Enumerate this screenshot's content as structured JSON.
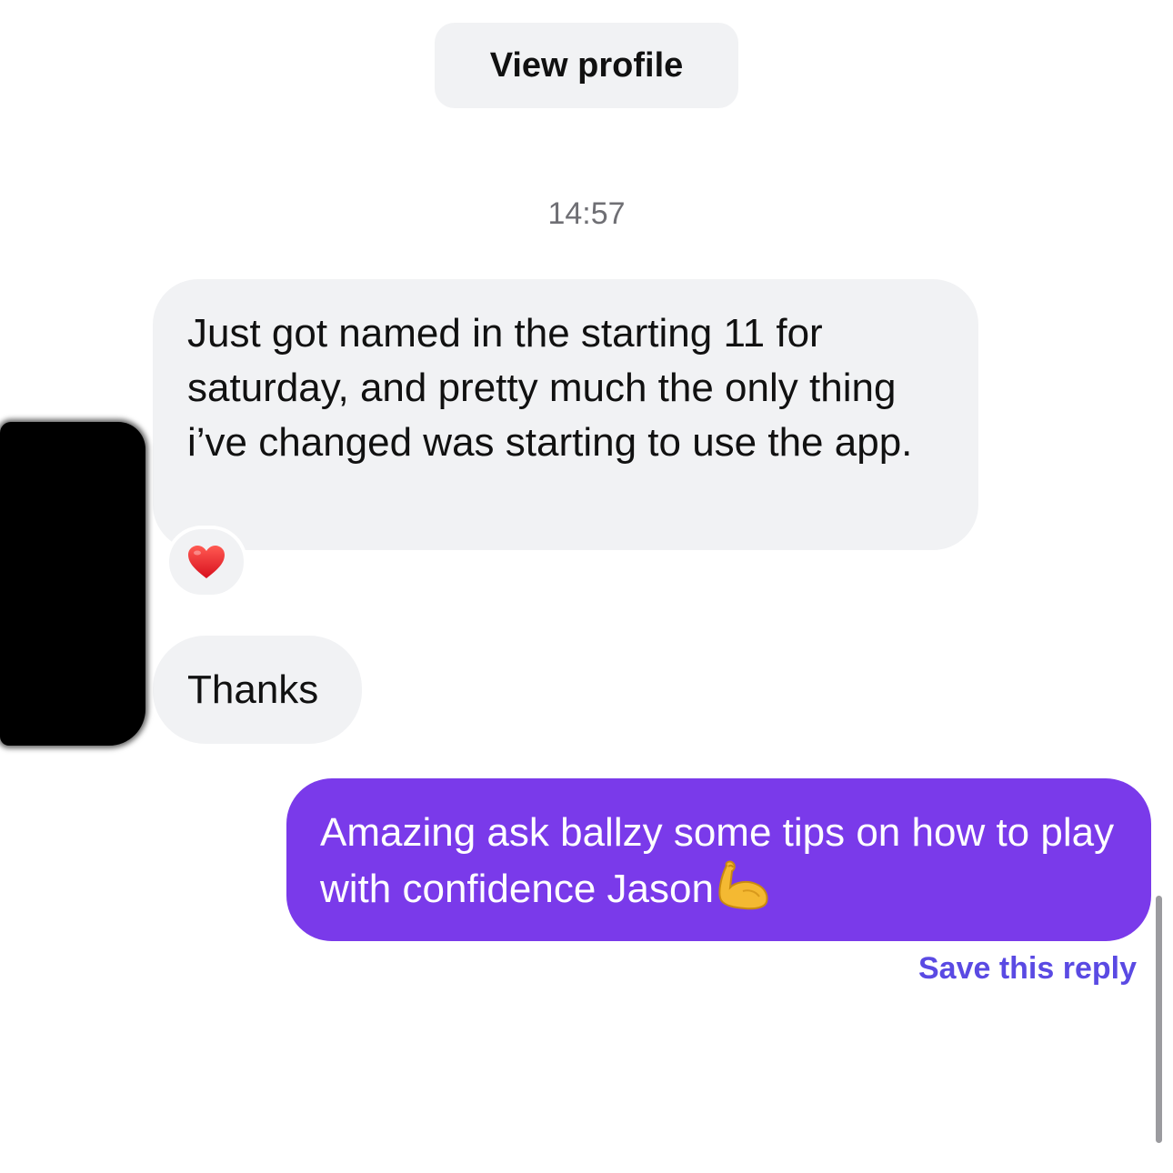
{
  "header": {
    "view_profile_label": "View profile"
  },
  "conversation": {
    "timestamp": "14:57",
    "incoming": [
      {
        "text": "Just got named in the starting 11 for saturday, and pretty much the only thing i’ve changed was starting to use the app.",
        "reaction_icon": "red-heart-icon"
      },
      {
        "text": "Thanks"
      }
    ],
    "outgoing": [
      {
        "text": "Amazing ask ballzy some tips on how to play with confidence Jason",
        "trailing_emoji": "flexed-biceps-icon"
      }
    ],
    "save_reply_label": "Save this reply"
  },
  "colors": {
    "incoming_bubble": "#f1f2f4",
    "outgoing_bubble": "#7a3aea",
    "link": "#5a4ae3",
    "timestamp": "#6f6f74"
  }
}
